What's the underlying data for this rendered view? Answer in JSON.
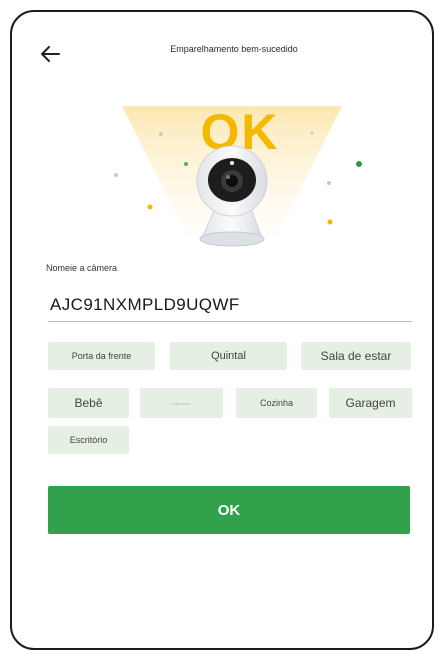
{
  "header": {
    "back_icon": "arrow-left-icon",
    "title": "Emparelhamento bem-sucedido"
  },
  "hero": {
    "badge_text": "OK",
    "icon": "security-camera-icon"
  },
  "name_field": {
    "label": "Nomeie a câmera",
    "value": "AJC91NXMPLD9UQWF"
  },
  "suggestions": [
    {
      "label": "Porta da frente"
    },
    {
      "label": "Quintal"
    },
    {
      "label": "Sala de estar"
    },
    {
      "label": "Bebê"
    },
    {
      "label": "••••••••••"
    },
    {
      "label": "Cozinha"
    },
    {
      "label": "Garagem"
    },
    {
      "label": "Escritório"
    }
  ],
  "primary_button": {
    "label": "OK"
  },
  "colors": {
    "accent": "#31a14b",
    "chip_bg": "#e6efe3",
    "badge": "#f5b800"
  }
}
